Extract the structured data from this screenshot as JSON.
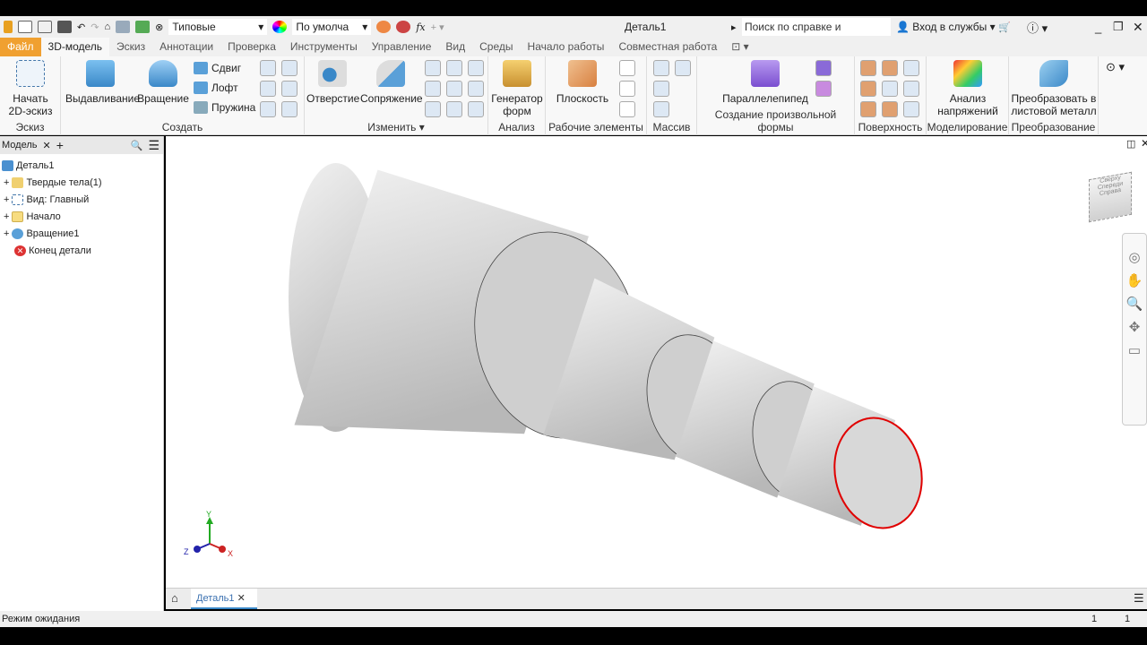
{
  "titlebar": {
    "style_combo": "Типовые",
    "appearance_combo": "По умолча",
    "document_title": "Деталь1",
    "search_placeholder": "Поиск по справке и командам.",
    "signin": "Вход в службы"
  },
  "tabs": [
    {
      "label": "Файл"
    },
    {
      "label": "3D-модель"
    },
    {
      "label": "Эскиз"
    },
    {
      "label": "Аннотации"
    },
    {
      "label": "Проверка"
    },
    {
      "label": "Инструменты"
    },
    {
      "label": "Управление"
    },
    {
      "label": "Вид"
    },
    {
      "label": "Среды"
    },
    {
      "label": "Начало работы"
    },
    {
      "label": "Совместная работа"
    }
  ],
  "ribbon": {
    "sketch": {
      "btn": "Начать 2D-эскиз",
      "label": "Эскиз"
    },
    "create": {
      "extrude": "Выдавливание",
      "revolve": "Вращение",
      "sweep": "Сдвиг",
      "loft": "Лофт",
      "coil": "Пружина",
      "label": "Создать"
    },
    "modify": {
      "hole": "Отверстие",
      "fillet": "Сопряжение",
      "label": "Изменить ▾"
    },
    "analysis": {
      "btn": "Генератор форм",
      "label": "Анализ"
    },
    "work": {
      "btn": "Плоскость",
      "label": "Рабочие элементы"
    },
    "pattern": {
      "label": "Массив"
    },
    "freeform": {
      "btn": "Параллелепипед",
      "label": "Создание произвольной формы"
    },
    "surface": {
      "label": "Поверхность"
    },
    "simulation": {
      "btn": "Анализ напряжений",
      "label": "Моделирование"
    },
    "convert": {
      "btn": "Преобразовать в листовой металл",
      "label": "Преобразование"
    }
  },
  "browser": {
    "tab": "Модель",
    "items": [
      {
        "label": "Деталь1"
      },
      {
        "label": "Твердые тела(1)"
      },
      {
        "label": "Вид: Главный"
      },
      {
        "label": "Начало"
      },
      {
        "label": "Вращение1"
      },
      {
        "label": "Конец детали"
      }
    ]
  },
  "viewcube": {
    "top": "Сверху",
    "front": "Спереди",
    "right": "Справа"
  },
  "axes": {
    "x": "X",
    "y": "Y",
    "z": "Z"
  },
  "doctab": "Деталь1",
  "status": {
    "text": "Режим ожидания",
    "n1": "1",
    "n2": "1"
  },
  "colors": {
    "file_tab": "#f0a030",
    "selection": "#e00000"
  }
}
